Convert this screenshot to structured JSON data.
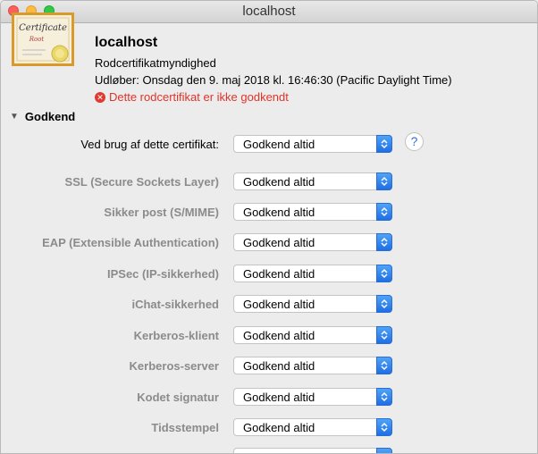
{
  "window": {
    "title": "localhost"
  },
  "certificate": {
    "icon": "certificate-icon",
    "icon_script": "Certificate",
    "icon_sub": "Root",
    "name": "localhost",
    "type": "Rodcertifikatmyndighed",
    "expires": "Udløber: Onsdag den 9. maj 2018 kl. 16:46:30 (Pacific Daylight Time)",
    "warning": "Dette rodcertifikat er ikke godkendt",
    "warning_icon": "error-x-icon"
  },
  "trust": {
    "section_label": "Godkend",
    "disclosure_icon": "triangle-down-icon",
    "main": {
      "label": "Ved brug af dette certifikat:",
      "value": "Godkend altid"
    },
    "help_label": "?",
    "rows": [
      {
        "label": "SSL (Secure Sockets Layer)",
        "value": "Godkend altid"
      },
      {
        "label": "Sikker post (S/MIME)",
        "value": "Godkend altid"
      },
      {
        "label": "EAP (Extensible Authentication)",
        "value": "Godkend altid"
      },
      {
        "label": "IPSec (IP-sikkerhed)",
        "value": "Godkend altid"
      },
      {
        "label": "iChat-sikkerhed",
        "value": "Godkend altid"
      },
      {
        "label": "Kerberos-klient",
        "value": "Godkend altid"
      },
      {
        "label": "Kerberos-server",
        "value": "Godkend altid"
      },
      {
        "label": "Kodet signatur",
        "value": "Godkend altid"
      },
      {
        "label": "Tidsstempel",
        "value": "Godkend altid"
      }
    ]
  },
  "colors": {
    "warning": "#e0332a",
    "accent": "#1f6fe5"
  }
}
